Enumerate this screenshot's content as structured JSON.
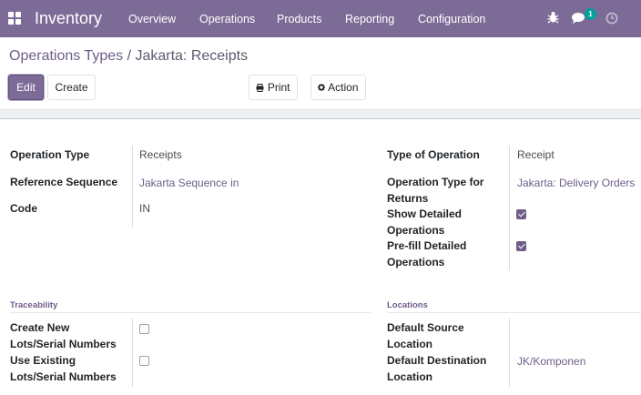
{
  "navbar": {
    "app_name": "Inventory",
    "menu": [
      "Overview",
      "Operations",
      "Products",
      "Reporting",
      "Configuration"
    ],
    "messages_badge": "1",
    "icons": [
      "apps-icon",
      "bug-icon",
      "chat-icon",
      "clock-icon"
    ],
    "bg_color": "#7c6b97"
  },
  "breadcrumb": {
    "parent": "Operations Types",
    "separator": "/",
    "current": "Jakarta: Receipts"
  },
  "buttons": {
    "edit": "Edit",
    "create": "Create",
    "print": "Print",
    "action": "Action"
  },
  "form": {
    "left": [
      {
        "label": "Operation Type",
        "value": "Receipts"
      },
      {
        "label": "Reference Sequence",
        "value": "Jakarta Sequence in"
      },
      {
        "label": "Code",
        "value": "IN"
      }
    ],
    "right": [
      {
        "label": "Type of Operation",
        "value": "Receipt"
      },
      {
        "label": "Operation Type for Returns",
        "value": "Jakarta: Delivery Orders"
      },
      {
        "label": "Show Detailed Operations",
        "checked": true
      },
      {
        "label": "Pre-fill Detailed Operations",
        "checked": true
      }
    ]
  },
  "traceability": {
    "title": "Traceability",
    "fields": [
      {
        "label": "Create New Lots/Serial Numbers",
        "checked": false
      },
      {
        "label": "Use Existing Lots/Serial Numbers",
        "checked": false
      }
    ]
  },
  "locations": {
    "title": "Locations",
    "fields": [
      {
        "label": "Default Source Location",
        "value": ""
      },
      {
        "label": "Default Destination Location",
        "value": "JK/Komponen"
      }
    ]
  }
}
